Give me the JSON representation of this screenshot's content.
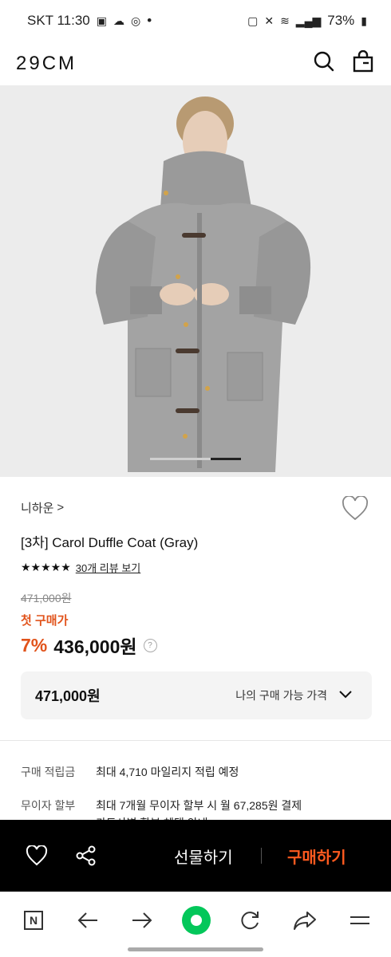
{
  "status": {
    "carrier_time": "SKT 11:30",
    "dot": "•",
    "battery": "73%"
  },
  "header": {
    "logo": "29CM"
  },
  "product": {
    "brand": "니하운",
    "brand_arrow": ">",
    "title": "[3차] Carol Duffle Coat (Gray)",
    "rating_stars": "★★★★★",
    "review_link": "30개 리뷰 보기",
    "original_price": "471,000원",
    "first_purchase_label": "첫 구매가",
    "discount": "7%",
    "sale_price": "436,000원",
    "help": "?"
  },
  "my_price": {
    "value": "471,000원",
    "label": "나의 구매 가능 가격"
  },
  "info": {
    "points_label": "구매 적립금",
    "points_value": "최대 4,710 마일리지 적립 예정",
    "installment_label": "무이자 할부",
    "installment_value": "최대 7개월 무이자 할부 시 월 67,285원 결제",
    "card_benefit": "카드사별 할부 혜택 안내"
  },
  "actions": {
    "gift": "선물하기",
    "buy": "구매하기"
  },
  "browser_nav": {
    "n_label": "N"
  },
  "colors": {
    "accent": "#e1531b",
    "buy": "#ff5a1f",
    "action_bar": "#000000",
    "naver_green": "#03c75a"
  }
}
